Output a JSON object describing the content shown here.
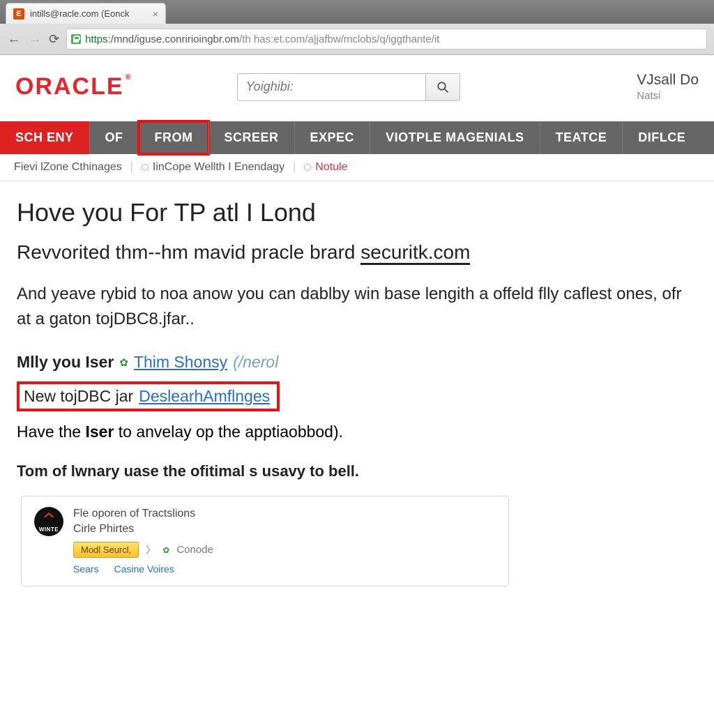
{
  "browser": {
    "tab_title": "intills@racle.com (Eonck",
    "tab_favicon_letter": "E",
    "url_scheme": "https",
    "url_host": ":/mnd/iguse.conririoingbr.om",
    "url_path": "/th has:et.com/a|jafbw/mclobs/q/iggthante/it"
  },
  "header": {
    "logo": "ORACLE",
    "logo_reg": "®",
    "search_placeholder": "Yoighibi:",
    "user_line1": "VJsall Do",
    "user_line2": "Natsi"
  },
  "nav": {
    "items": [
      "SCH ENY",
      "OF",
      "FROM",
      "SCREER",
      "EXPEC",
      "VIOTPLE MAGENIALS",
      "TEATCE",
      "DIFLCE"
    ]
  },
  "subbar": {
    "items": [
      {
        "label": "Fievi lZone Cthinages",
        "style": "plain"
      },
      {
        "label": "IinCope Wellth I Enendagy",
        "style": "pill"
      },
      {
        "label": "Notule",
        "style": "pill-red"
      }
    ]
  },
  "content": {
    "h1": "Hove you For TP atl I Lond",
    "subhead_pre": "Revvorited thm--hm mavid pracle brard ",
    "subhead_u": "securitk.com",
    "para": "And yeave rybid to noa anow you can dablby win base lengith a offeld flly caflest ones, ofr at a gaton tojDBC8.jfar..",
    "row1_bold": "Mlly you Iser",
    "row1_link1": "Thim Shonsy",
    "row1_link2": "(/nerol",
    "row_box_pre": "New tojDBC jar ",
    "row_box_link": "DeslearhAmflnges",
    "under_red_pre": "Have the ",
    "under_red_bold": "Iser",
    "under_red_post": " to anvelay op the apptiaobbod).",
    "bold_para": "Tom of lwnary uase the ofitimal s usavy to bell."
  },
  "card": {
    "avatar_label": "WINTE",
    "title": "Fle oporen of Tractslions",
    "subtitle": "Cirle Phirtes",
    "button": "Modl Seurcl,",
    "after_btn": "Conode",
    "links": [
      "Sears",
      "Casine Voires"
    ]
  }
}
